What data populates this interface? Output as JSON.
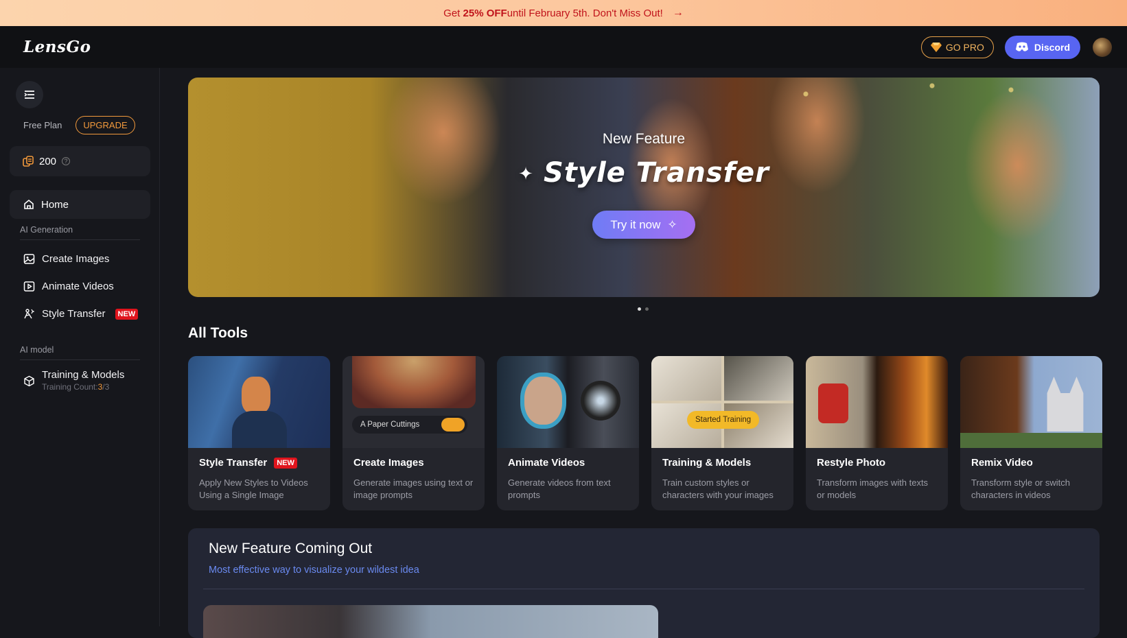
{
  "promo": {
    "prefix": "Get ",
    "highlight": "25% OFF",
    "suffix": " until February 5th. Don't Miss Out!",
    "arrow": "→"
  },
  "header": {
    "logo": "LensGo",
    "gopro_label": "GO PRO",
    "discord_label": "Discord"
  },
  "sidebar": {
    "plan": "Free Plan",
    "upgrade_label": "UPGRADE",
    "credits": "200",
    "home_label": "Home",
    "section_generation": "AI Generation",
    "items_generation": [
      {
        "label": "Create Images",
        "icon": "image-icon"
      },
      {
        "label": "Animate Videos",
        "icon": "video-icon"
      },
      {
        "label": "Style Transfer",
        "icon": "style-transfer-icon",
        "badge": "NEW"
      }
    ],
    "section_model": "AI model",
    "training": {
      "label": "Training & Models",
      "sub_prefix": "Training Count:",
      "count_used": "3",
      "count_total": "/3"
    }
  },
  "hero": {
    "eyebrow": "New Feature",
    "title": "Style Transfer",
    "cta": "Try it now",
    "slides": 2,
    "active_slide": 0
  },
  "tools_title": "All Tools",
  "tools": [
    {
      "title": "Style Transfer",
      "badge": "NEW",
      "desc": "Apply New Styles to Videos Using a Single Image"
    },
    {
      "title": "Create Images",
      "desc": "Generate images using text or image prompts",
      "thumb_text": "A Paper Cuttings"
    },
    {
      "title": "Animate Videos",
      "desc": "Generate videos from text prompts"
    },
    {
      "title": "Training & Models",
      "desc": "Train custom styles or characters with your images",
      "thumb_text": "Started Training"
    },
    {
      "title": "Restyle Photo",
      "desc": "Transform images with texts or models"
    },
    {
      "title": "Remix Video",
      "desc": "Transform style or switch characters in videos"
    }
  ],
  "feature": {
    "title": "New Feature Coming Out",
    "subtitle": "Most effective way to visualize your wildest idea"
  },
  "colors": {
    "accent_orange": "#f39a3c",
    "badge_red": "#e0141d",
    "discord_blue": "#5865f2",
    "promo_text": "#c0131b"
  }
}
